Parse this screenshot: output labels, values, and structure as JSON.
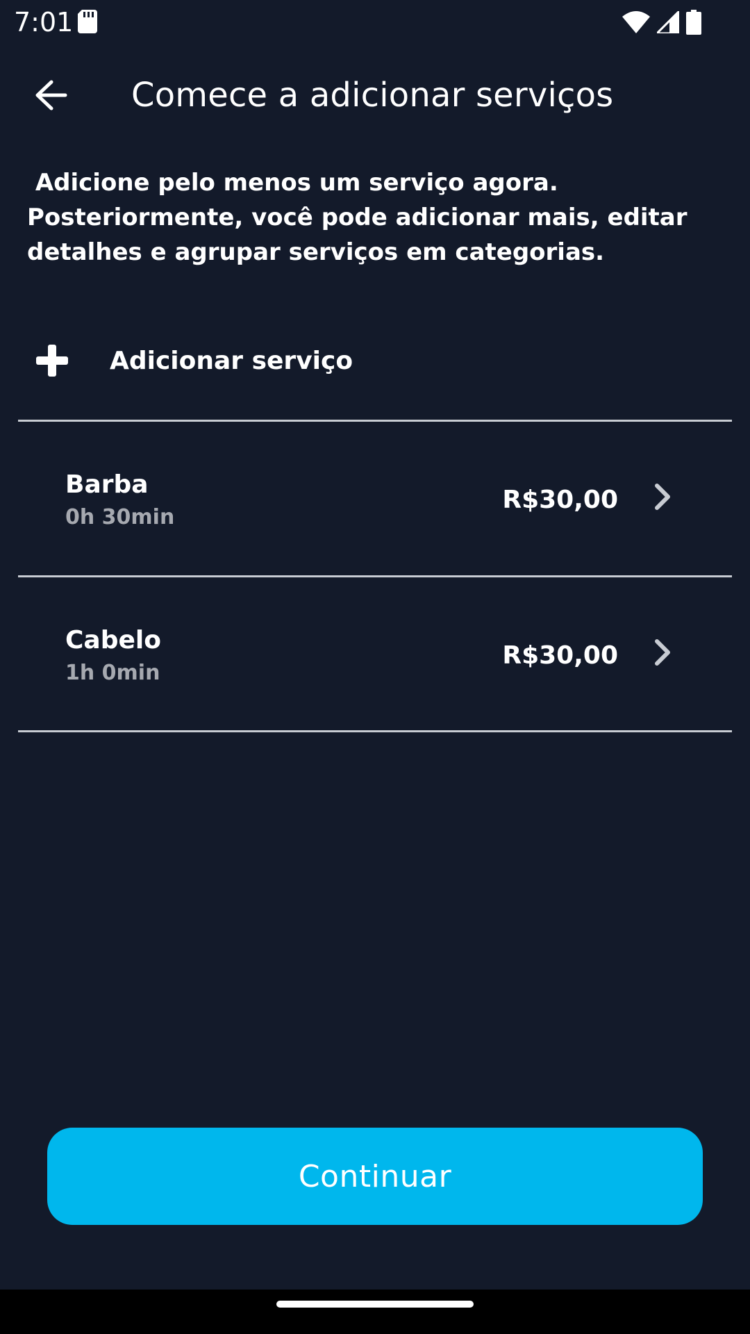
{
  "status_bar": {
    "time": "7:01",
    "icons": [
      "sd-card-icon",
      "wifi-icon",
      "cell-signal-icon",
      "battery-icon"
    ]
  },
  "header": {
    "title": "Comece a adicionar serviços",
    "back_icon": "back-arrow-icon"
  },
  "description": " Adicione pelo menos um serviço agora. Posteriormente, você pode adicionar mais, editar detalhes e agrupar serviços em categorias.",
  "add_service": {
    "icon": "plus-icon",
    "label": "Adicionar serviço"
  },
  "services": [
    {
      "name": "Barba",
      "duration": "0h 30min",
      "price": "R$30,00"
    },
    {
      "name": "Cabelo",
      "duration": "1h 0min",
      "price": "R$30,00"
    }
  ],
  "continue_button": {
    "label": "Continuar"
  },
  "colors": {
    "background": "#131a2a",
    "accent": "#00b7ed",
    "divider": "#c8ccd3",
    "secondary_text": "#a6a9b0"
  }
}
